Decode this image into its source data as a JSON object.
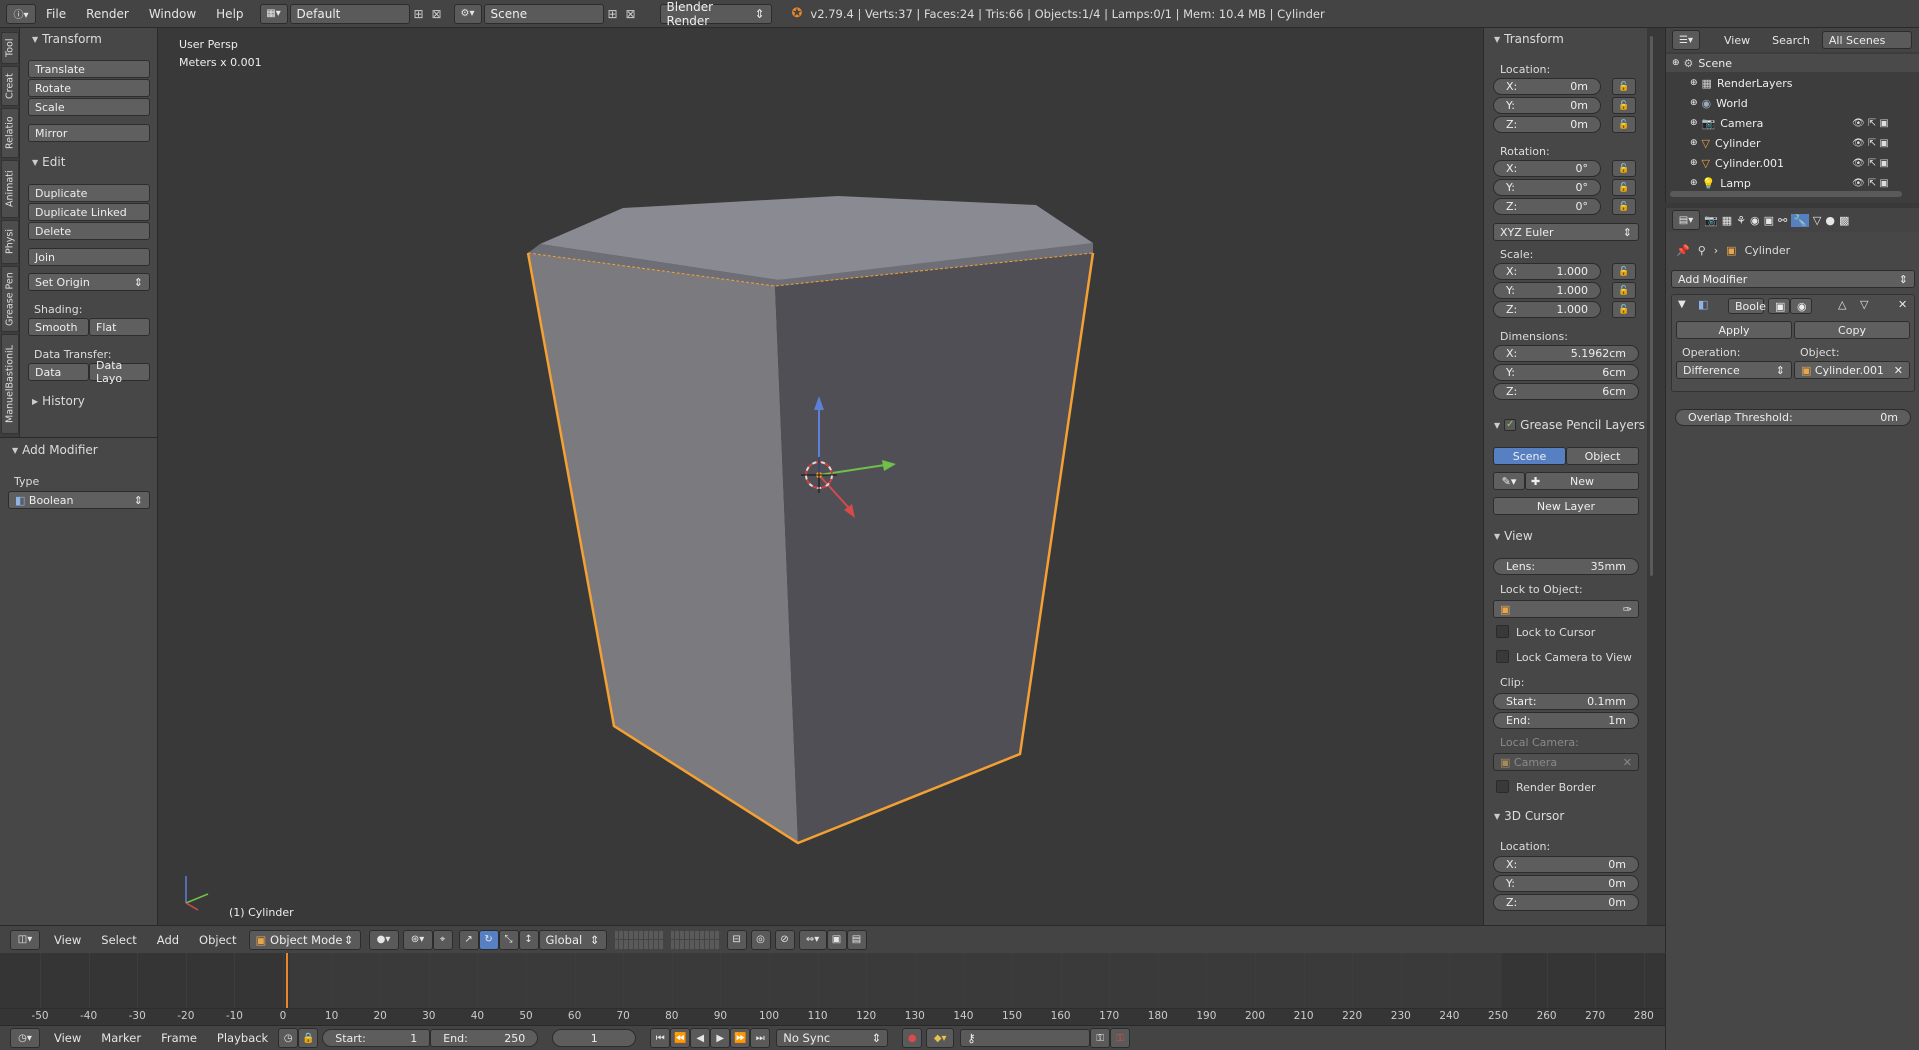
{
  "topbar": {
    "menus": [
      "File",
      "Render",
      "Window",
      "Help"
    ],
    "layout": "Default",
    "scene": "Scene",
    "engine": "Blender Render",
    "status": "v2.79.4 | Verts:37 | Faces:24 | Tris:66 | Objects:1/4 | Lamps:0/1 | Mem: 10.4 MB | Cylinder"
  },
  "sidetabs": [
    "Tool",
    "Creat",
    "Relatio",
    "Animati",
    "Physi",
    "Grease Pen",
    "ManuelBastioniL"
  ],
  "toolshelf": {
    "transform_title": "Transform",
    "transform_buttons": [
      "Translate",
      "Rotate",
      "Scale",
      "Mirror"
    ],
    "edit_title": "Edit",
    "edit_buttons": [
      "Duplicate",
      "Duplicate Linked",
      "Delete",
      "Join"
    ],
    "set_origin": "Set Origin",
    "shading_label": "Shading:",
    "smooth": "Smooth",
    "flat": "Flat",
    "data_transfer_label": "Data Transfer:",
    "data": "Data",
    "data_layout": "Data Layo",
    "history_title": "History",
    "add_modifier_title": "Add Modifier",
    "type_label": "Type",
    "type_value": "Boolean"
  },
  "viewport": {
    "view_name": "User Persp",
    "units": "Meters x 0.001",
    "object_label": "(1) Cylinder"
  },
  "npanel": {
    "transform_title": "Transform",
    "location_label": "Location:",
    "location": [
      {
        "axis": "X:",
        "val": "0m"
      },
      {
        "axis": "Y:",
        "val": "0m"
      },
      {
        "axis": "Z:",
        "val": "0m"
      }
    ],
    "rotation_label": "Rotation:",
    "rotation": [
      {
        "axis": "X:",
        "val": "0°"
      },
      {
        "axis": "Y:",
        "val": "0°"
      },
      {
        "axis": "Z:",
        "val": "0°"
      }
    ],
    "rotation_mode": "XYZ Euler",
    "scale_label": "Scale:",
    "scale": [
      {
        "axis": "X:",
        "val": "1.000"
      },
      {
        "axis": "Y:",
        "val": "1.000"
      },
      {
        "axis": "Z:",
        "val": "1.000"
      }
    ],
    "dimensions_label": "Dimensions:",
    "dimensions": [
      {
        "axis": "X:",
        "val": "5.1962cm"
      },
      {
        "axis": "Y:",
        "val": "6cm"
      },
      {
        "axis": "Z:",
        "val": "6cm"
      }
    ],
    "gp_title": "Grease Pencil Layers",
    "gp_scene": "Scene",
    "gp_object": "Object",
    "gp_new": "New",
    "gp_new_layer": "New Layer",
    "view_title": "View",
    "lens_label": "Lens:",
    "lens_val": "35mm",
    "lock_to_object": "Lock to Object:",
    "lock_to_cursor": "Lock to Cursor",
    "lock_camera": "Lock Camera to View",
    "clip_label": "Clip:",
    "clip_start_label": "Start:",
    "clip_start": "0.1mm",
    "clip_end_label": "End:",
    "clip_end": "1m",
    "local_camera": "Local Camera:",
    "camera": "Camera",
    "render_border": "Render Border",
    "cursor_title": "3D Cursor",
    "cursor_location_label": "Location:",
    "cursor": [
      {
        "axis": "X:",
        "val": "0m"
      },
      {
        "axis": "Y:",
        "val": "0m"
      },
      {
        "axis": "Z:",
        "val": "0m"
      }
    ]
  },
  "outliner": {
    "header": [
      "View",
      "Search",
      "All Scenes"
    ],
    "rows": [
      {
        "name": "Scene",
        "indent": 0
      },
      {
        "name": "RenderLayers",
        "indent": 1
      },
      {
        "name": "World",
        "indent": 1
      },
      {
        "name": "Camera",
        "indent": 1
      },
      {
        "name": "Cylinder",
        "indent": 1
      },
      {
        "name": "Cylinder.001",
        "indent": 1
      },
      {
        "name": "Lamp",
        "indent": 1
      }
    ]
  },
  "properties": {
    "breadcrumb": "Cylinder",
    "add_modifier": "Add Modifier",
    "modifier_name": "Boole",
    "apply": "Apply",
    "copy": "Copy",
    "operation_label": "Operation:",
    "object_label": "Object:",
    "operation": "Difference",
    "object": "Cylinder.001",
    "overlap_label": "Overlap Threshold:",
    "overlap": "0m"
  },
  "view3d_header": {
    "menus": [
      "View",
      "Select",
      "Add",
      "Object"
    ],
    "mode": "Object Mode",
    "orientation": "Global"
  },
  "timeline": {
    "ticks": [
      "-50",
      "-40",
      "-30",
      "-20",
      "-10",
      "0",
      "10",
      "20",
      "30",
      "40",
      "50",
      "60",
      "70",
      "80",
      "90",
      "100",
      "110",
      "120",
      "130",
      "140",
      "150",
      "160",
      "170",
      "180",
      "190",
      "200",
      "210",
      "220",
      "230",
      "240",
      "250",
      "260",
      "270",
      "280"
    ]
  },
  "timeline_header": {
    "menus": [
      "View",
      "Marker",
      "Frame",
      "Playback"
    ],
    "start_label": "Start:",
    "start": "1",
    "end_label": "End:",
    "end": "250",
    "current": "1",
    "sync": "No Sync"
  },
  "colors": {
    "selection": "#f5a033",
    "accent": "#5680c2",
    "bg": "#393939"
  }
}
